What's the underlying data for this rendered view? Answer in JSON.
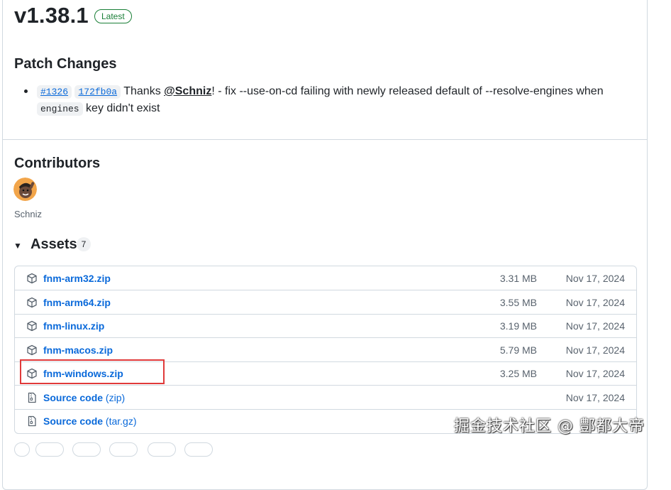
{
  "release": {
    "version": "v1.38.1",
    "badge": "Latest"
  },
  "patch_changes": {
    "title": "Patch Changes",
    "items": [
      {
        "pr": "#1326",
        "commit": "172fb0a",
        "text_thanks": " Thanks ",
        "mention": "@Schniz",
        "text_rest": "! - fix --use-on-cd failing with newly released default of --resolve-engines when",
        "code_word": "engines",
        "text_end": " key didn't exist"
      }
    ]
  },
  "contributors": {
    "title": "Contributors",
    "names": [
      "Schniz"
    ]
  },
  "assets": {
    "title": "Assets",
    "count": "7",
    "items": [
      {
        "name": "fnm-arm32.zip",
        "size": "3.31 MB",
        "date": "Nov 17, 2024",
        "icon": "package-icon"
      },
      {
        "name": "fnm-arm64.zip",
        "size": "3.55 MB",
        "date": "Nov 17, 2024",
        "icon": "package-icon"
      },
      {
        "name": "fnm-linux.zip",
        "size": "3.19 MB",
        "date": "Nov 17, 2024",
        "icon": "package-icon"
      },
      {
        "name": "fnm-macos.zip",
        "size": "5.79 MB",
        "date": "Nov 17, 2024",
        "icon": "package-icon"
      },
      {
        "name": "fnm-windows.zip",
        "size": "3.25 MB",
        "date": "Nov 17, 2024",
        "icon": "package-icon"
      },
      {
        "name": "Source code",
        "suffix": " (zip)",
        "size": "",
        "date": "Nov 17, 2024",
        "icon": "file-zip-icon"
      },
      {
        "name": "Source code",
        "suffix": " (tar.gz)",
        "size": "",
        "date": "",
        "icon": "file-zip-icon"
      }
    ]
  },
  "watermark": "掘金技术社区 @ 鄷都大帝",
  "colors": {
    "link": "#0969da",
    "latest_badge": "#1a7f37",
    "highlight": "#e03a3a",
    "border": "#d1d9e0"
  }
}
